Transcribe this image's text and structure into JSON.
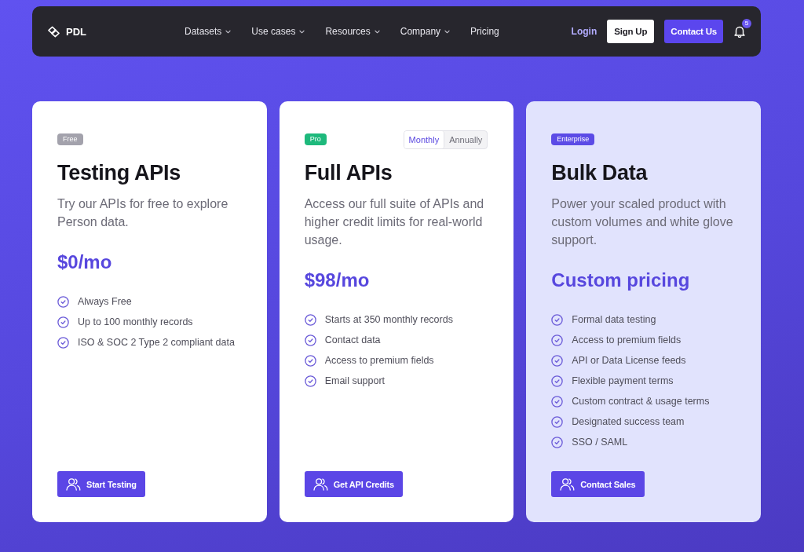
{
  "nav": {
    "brand": "PDL",
    "menu": [
      {
        "label": "Datasets",
        "has_dropdown": true
      },
      {
        "label": "Use cases",
        "has_dropdown": true
      },
      {
        "label": "Resources",
        "has_dropdown": true
      },
      {
        "label": "Company",
        "has_dropdown": true
      },
      {
        "label": "Pricing",
        "has_dropdown": false
      }
    ],
    "login": "Login",
    "sign_up": "Sign Up",
    "contact": "Contact Us",
    "notification_count": "5"
  },
  "plans": [
    {
      "badge": "Free",
      "color": "#a3a2ac",
      "title": "Testing APIs",
      "description": "Try our APIs for free to explore Person data.",
      "price": "$0/mo",
      "features": [
        "Always Free",
        "Up to 100 monthly records",
        "ISO & SOC 2 Type 2 compliant data"
      ],
      "button": "Start Testing",
      "highlighted": false
    },
    {
      "badge": "Pro",
      "color": "#1eb97c",
      "billing_toggle": [
        {
          "label": "Monthly",
          "selected": true
        },
        {
          "label": "Annually",
          "selected": false
        }
      ],
      "title": "Full APIs",
      "description": "Access our full suite of APIs and higher credit limits for real-world usage.",
      "price": "$98/mo",
      "features": [
        "Starts at 350 monthly records",
        "Contact data",
        "Access to premium fields",
        "Email support"
      ],
      "button": "Get API Credits",
      "highlighted": false
    },
    {
      "badge": "Enterprise",
      "color": "#5b4be6",
      "title": "Bulk Data",
      "description": "Power your scaled product with custom volumes and white glove support.",
      "price": "Custom pricing",
      "features": [
        "Formal data testing",
        "Access to premium fields",
        "API or Data License feeds",
        "Flexible payment terms",
        "Custom contract & usage terms",
        "Designated success team",
        "SSO / SAML"
      ],
      "button": "Contact Sales",
      "highlighted": true
    }
  ]
}
